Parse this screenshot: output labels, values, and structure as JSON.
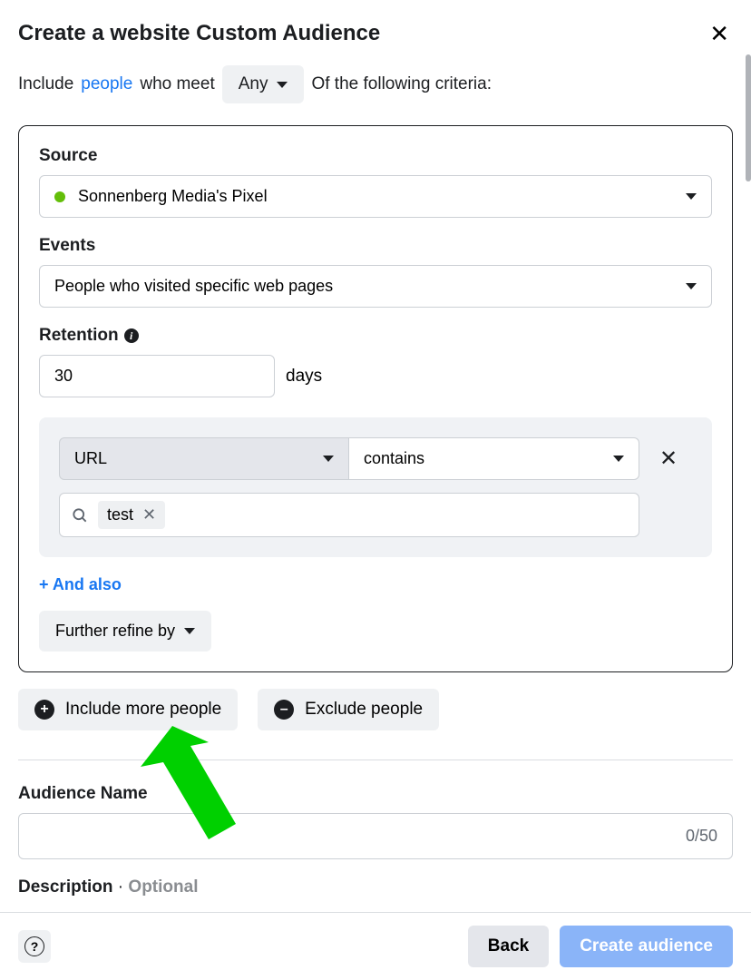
{
  "header": {
    "title": "Create a website Custom Audience"
  },
  "include": {
    "prefix": "Include",
    "link": "people",
    "mid": "who meet",
    "dropdown": "Any",
    "suffix": "Of the following criteria:"
  },
  "criteria": {
    "source": {
      "label": "Source",
      "value": "Sonnenberg Media's Pixel"
    },
    "events": {
      "label": "Events",
      "value": "People who visited specific web pages"
    },
    "retention": {
      "label": "Retention",
      "value": "30",
      "unit": "days"
    },
    "url_block": {
      "field": "URL",
      "operator": "contains",
      "tag": "test"
    },
    "and_also": "+ And also",
    "refine": "Further refine by"
  },
  "actions": {
    "include_more": "Include more people",
    "exclude": "Exclude people"
  },
  "name_section": {
    "label": "Audience Name",
    "counter": "0/50"
  },
  "description_section": {
    "label": "Description",
    "separator": " · ",
    "optional": "Optional"
  },
  "footer": {
    "back": "Back",
    "create": "Create audience"
  }
}
